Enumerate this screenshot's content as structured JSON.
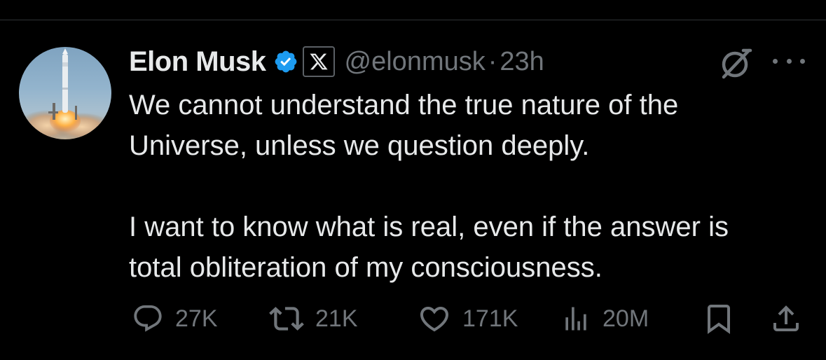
{
  "tweet": {
    "author": {
      "display_name": "Elon Musk",
      "handle": "@elonmusk",
      "verified": true,
      "affiliate_badge": "x-logo",
      "avatar": "rocket-launch-photo"
    },
    "separator": "·",
    "time": "23h",
    "text": {
      "paragraph_1": "We cannot understand the true nature of the\nUniverse, unless we question deeply.",
      "paragraph_2": "I want to know what is real, even if the answer is\ntotal obliteration of my consciousness."
    },
    "stats": {
      "replies": "27K",
      "reposts": "21K",
      "likes": "171K",
      "views": "20M"
    },
    "icons": {
      "grok": "grok-icon",
      "more": "more-icon",
      "reply": "reply-icon",
      "repost": "repost-icon",
      "like": "like-icon",
      "views": "views-icon",
      "bookmark": "bookmark-icon",
      "share": "share-icon"
    }
  },
  "colors": {
    "background": "#000000",
    "text_primary": "#e7e9ea",
    "text_secondary": "#71767b",
    "verified_blue": "#1d9bf0",
    "divider": "#2f3336"
  }
}
